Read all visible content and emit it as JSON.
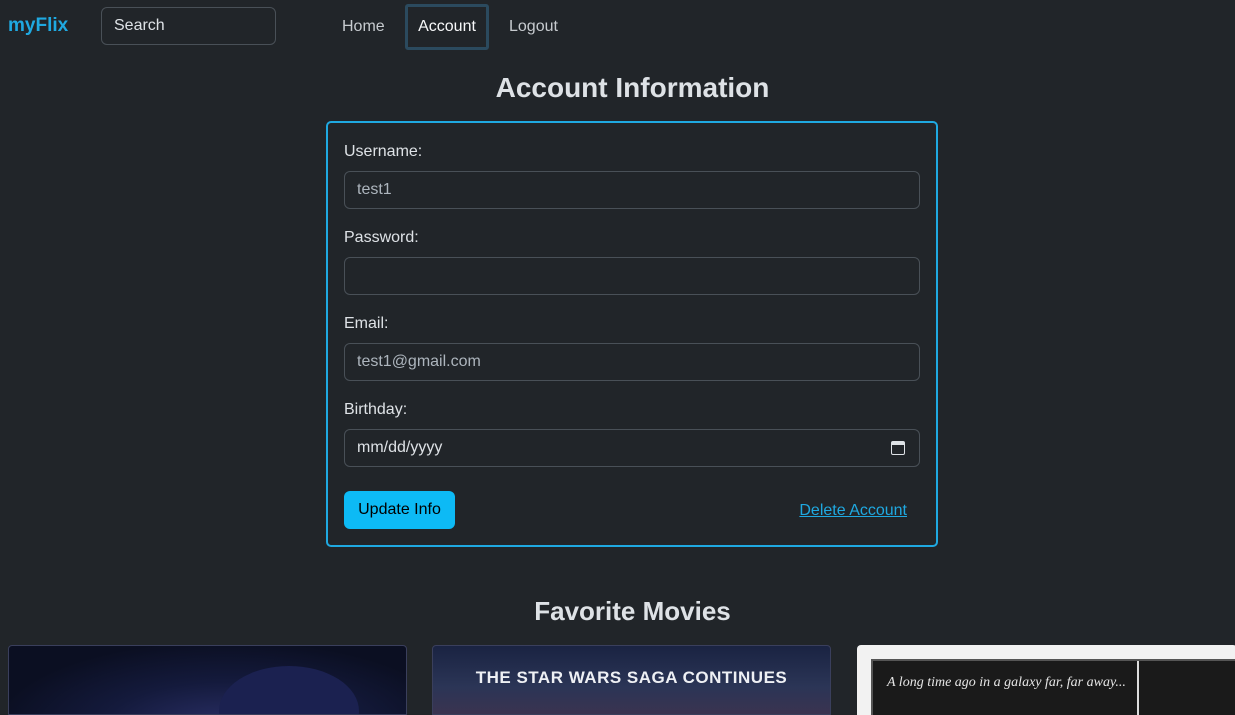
{
  "nav": {
    "brand": "myFlix",
    "search_placeholder": "Search",
    "links": [
      "Home",
      "Account",
      "Logout"
    ],
    "active": "Account"
  },
  "account": {
    "title": "Account Information",
    "username_label": "Username:",
    "username_value": "test1",
    "password_label": "Password:",
    "password_value": "",
    "email_label": "Email:",
    "email_value": "test1@gmail.com",
    "birthday_label": "Birthday:",
    "birthday_placeholder": "mm/dd/yyyy",
    "update_label": "Update Info",
    "delete_label": "Delete Account"
  },
  "favorites": {
    "title": "Favorite Movies",
    "posters": [
      {
        "text": ""
      },
      {
        "text": "THE STAR WARS SAGA CONTINUES"
      },
      {
        "text": "A long time ago in a galaxy far, far away..."
      }
    ]
  },
  "colors": {
    "background": "#212529",
    "accent": "#1fa9e1",
    "button": "#0dbaf5"
  }
}
